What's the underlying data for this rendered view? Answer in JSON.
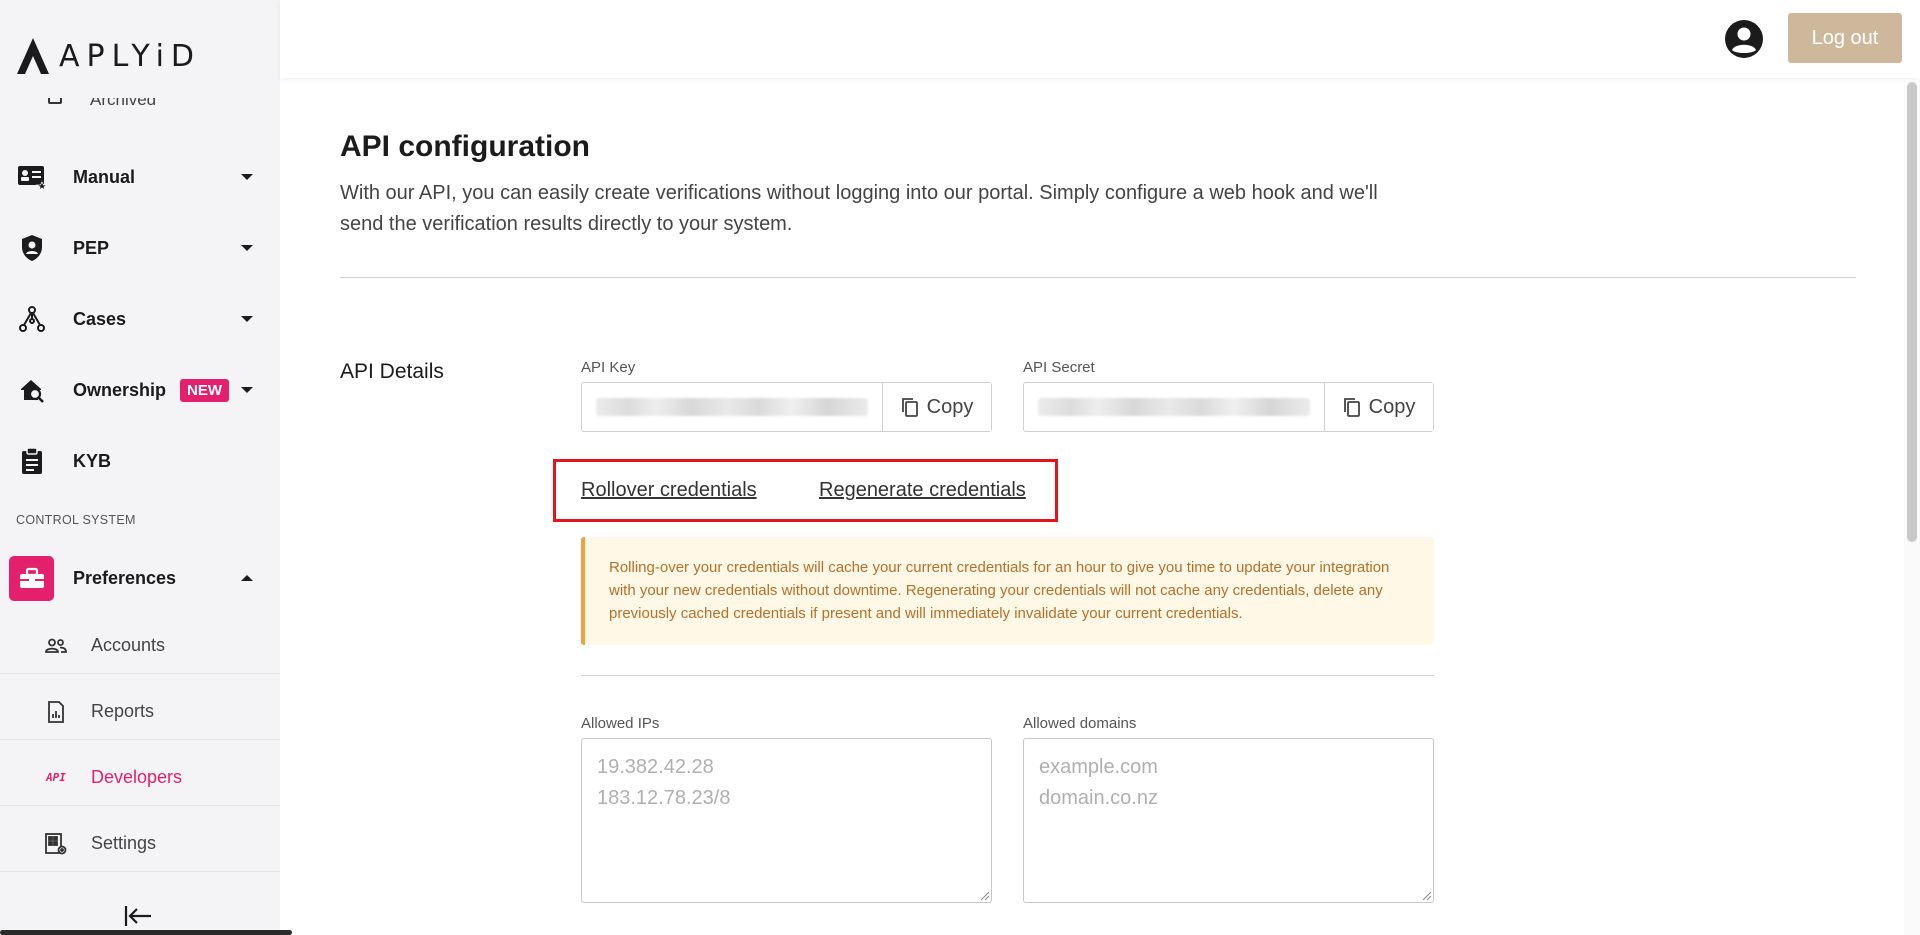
{
  "brand": {
    "name": "APLYiD"
  },
  "sidebar": {
    "cut_off_item": "Archived",
    "items": [
      {
        "label": "Manual",
        "icon": "id-card-icon"
      },
      {
        "label": "PEP",
        "icon": "shield-person-icon"
      },
      {
        "label": "Cases",
        "icon": "network-icon"
      },
      {
        "label": "Ownership",
        "icon": "home-search-icon",
        "badge": "NEW"
      },
      {
        "label": "KYB",
        "icon": "clipboard-icon"
      }
    ],
    "section_label": "CONTROL SYSTEM",
    "preferences": {
      "label": "Preferences",
      "icon": "toolbox-icon",
      "expanded": true
    },
    "sub_items": [
      {
        "label": "Accounts",
        "icon": "people-icon"
      },
      {
        "label": "Reports",
        "icon": "report-icon"
      },
      {
        "label": "Developers",
        "icon": "api-icon",
        "glyph": "API",
        "active": true
      },
      {
        "label": "Settings",
        "icon": "settings-grid-icon"
      }
    ]
  },
  "header": {
    "logout_label": "Log out",
    "logout_color": "#cdb89b"
  },
  "main": {
    "title": "API configuration",
    "description": "With our API, you can easily create verifications without logging into our portal. Simply configure a web hook and we'll send the verification results directly to your system.",
    "section_title": "API Details",
    "api_key": {
      "label": "API Key",
      "copy_label": "Copy"
    },
    "api_secret": {
      "label": "API Secret",
      "copy_label": "Copy"
    },
    "rollover_label": "Rollover credentials",
    "regenerate_label": "Regenerate credentials",
    "warning_text": "Rolling-over your credentials will cache your current credentials for an hour to give you time to update your integration with your new credentials without downtime. Regenerating your credentials will not cache any credentials, delete any previously cached credentials if present and will immediately invalidate your current credentials.",
    "allowed_ips": {
      "label": "Allowed IPs",
      "placeholder": "19.382.42.28\n183.12.78.23/8"
    },
    "allowed_domains": {
      "label": "Allowed domains",
      "placeholder": "example.com\ndomain.co.nz"
    }
  },
  "colors": {
    "accent": "#e4206c",
    "warning_border": "#f0a33b",
    "highlight": "#e3141b"
  }
}
